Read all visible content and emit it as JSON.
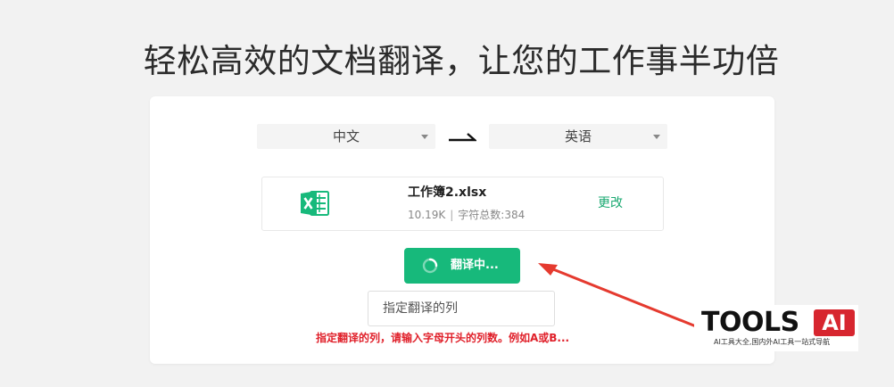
{
  "headline": "轻松高效的文档翻译，让您的工作事半功倍",
  "language": {
    "source": "中文",
    "target": "英语"
  },
  "file": {
    "name": "工作簿2.xlsx",
    "size": "10.19K",
    "char_count_label": "字符总数:384",
    "change_label": "更改",
    "icon": "excel-icon"
  },
  "translate_button": {
    "label": "翻译中...",
    "icon": "loading-spinner-icon"
  },
  "column_input": {
    "value": "",
    "placeholder": "指定翻译的列"
  },
  "hint": "指定翻译的列，请输入字母开头的列数。例如A或B...",
  "watermark": {
    "brand": "TOOLS",
    "badge": "AI",
    "tagline": "AI工具大全,国内外AI工具一站式导航"
  },
  "colors": {
    "accent": "#17b97b",
    "link": "#1aa971",
    "error": "#e0202a",
    "annotation": "#e53a2f"
  }
}
